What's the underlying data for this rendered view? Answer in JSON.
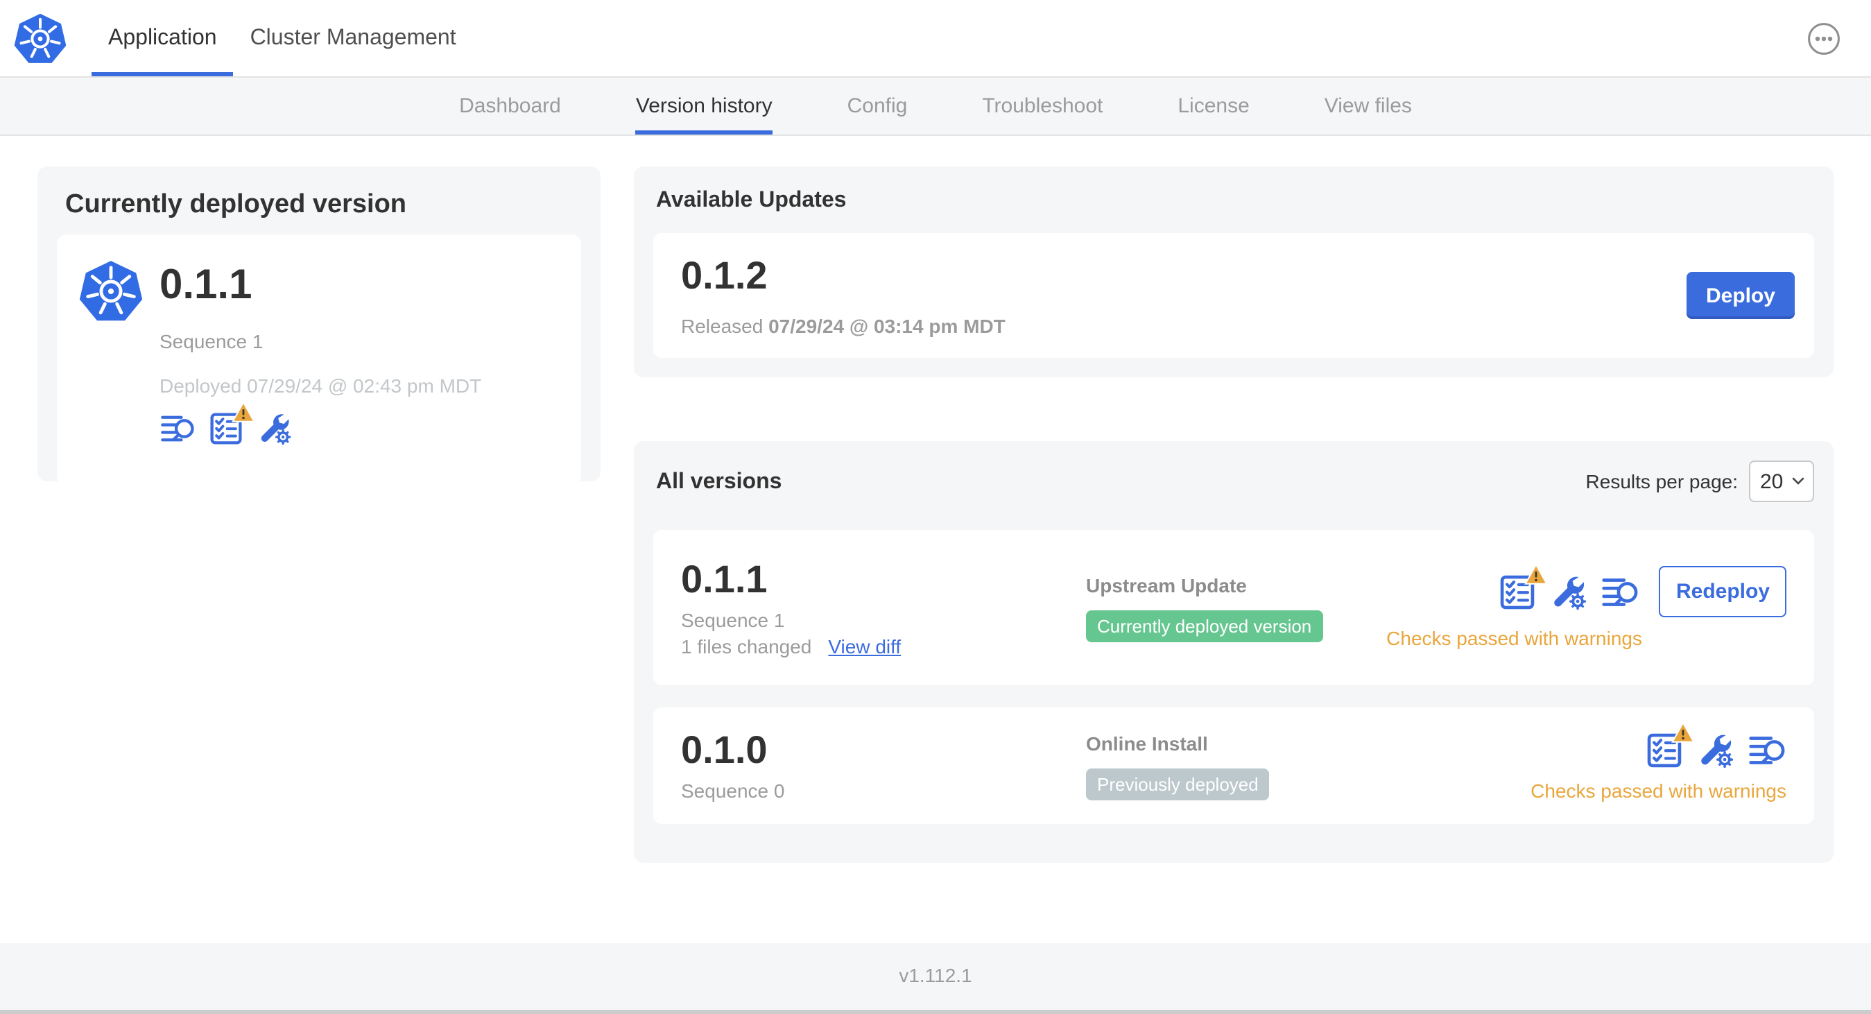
{
  "nav": {
    "app_tab": "Application",
    "cluster_tab": "Cluster Management",
    "more_icon": "ellipsis-menu-icon"
  },
  "subnav": {
    "active": "Version history",
    "tabs": {
      "dashboard": "Dashboard",
      "version_history": "Version history",
      "config": "Config",
      "troubleshoot": "Troubleshoot",
      "license": "License",
      "view_files": "View files"
    }
  },
  "deployed": {
    "title": "Currently deployed version",
    "version": "0.1.1",
    "sequence": "Sequence 1",
    "deployed_at": "Deployed 07/29/24 @ 02:43 pm MDT",
    "icons": [
      "diff-summary-icon",
      "preflight-checks-warning-icon",
      "edit-config-icon"
    ]
  },
  "updates": {
    "title": "Available Updates",
    "version": "0.1.2",
    "released_label": "Released",
    "released_date": "07/29/24 @ 03:14 pm MDT",
    "deploy_label": "Deploy"
  },
  "versions": {
    "title": "All versions",
    "per_page_label": "Results per page:",
    "per_page_value": "20",
    "rows": [
      {
        "version": "0.1.1",
        "sequence": "Sequence 1",
        "files_changed": "1 files changed",
        "view_diff_label": "View diff",
        "source": "Upstream Update",
        "badge": "Currently deployed version",
        "badge_color": "#66C690",
        "icons": [
          "preflight-checks-warning-icon",
          "edit-config-icon",
          "deploy-logs-icon"
        ],
        "action_label": "Redeploy",
        "status": "Checks passed with warnings"
      },
      {
        "version": "0.1.0",
        "sequence": "Sequence 0",
        "source": "Online Install",
        "badge": "Previously deployed",
        "badge_color": "#BCC8CC",
        "icons": [
          "preflight-checks-warning-icon",
          "edit-config-icon",
          "deploy-logs-icon"
        ],
        "status": "Checks passed with warnings"
      }
    ]
  },
  "footer": {
    "app_version": "v1.112.1"
  },
  "colors": {
    "primary_blue": "#3B6CDE",
    "kubernetes_blue": "#326CE5",
    "badge_green": "#66C690",
    "badge_slate": "#BCC8CC",
    "warning_amber": "#E9A63D",
    "panel_gray": "#F5F6F8",
    "text_dark": "#323232",
    "text_gray": "#9B9B9B"
  }
}
